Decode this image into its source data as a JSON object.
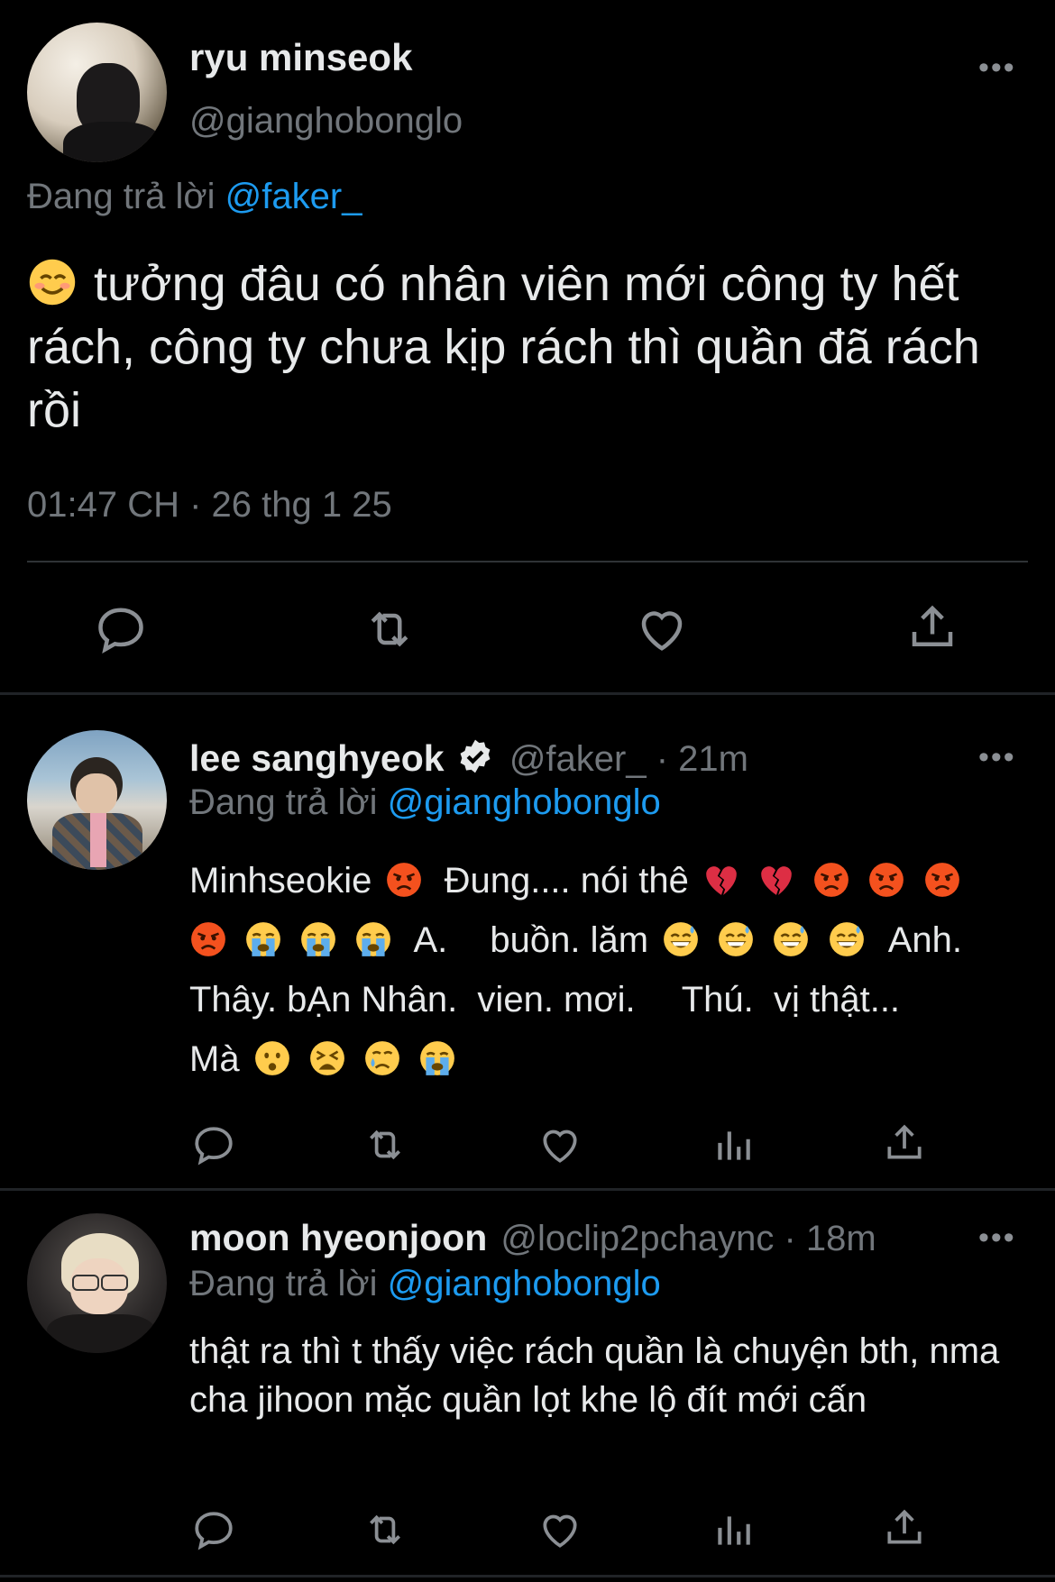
{
  "main_tweet": {
    "name": "ryu minseok",
    "handle": "@gianghobonglo",
    "replying_label": "Đang trả lời",
    "replying_to": "@faker_",
    "text": "tưởng đâu có nhân viên mới công ty hết rách, công ty chưa kịp rách thì quần đã rách rồi",
    "timestamp": "01:47 CH · 26 thg 1 25",
    "more_label": "•••"
  },
  "replies": [
    {
      "name": "lee sanghyeok",
      "verified": true,
      "handle": "@faker_",
      "time": "· 21m",
      "replying_label": "Đang trả lời",
      "replying_to": "@gianghobonglo",
      "text_segments": {
        "s1": "Minhseokie",
        "s2": "Đung.... nói thê",
        "s3": "A.",
        "s4": "buồn. lăm",
        "s5": "Anh.",
        "s6": "Thây. bẠn Nhân.  vien. mơi.",
        "s7": "Thú.  vị thật...",
        "s8": "Mà"
      },
      "more_label": "•••"
    },
    {
      "name": "moon hyeonjoon",
      "handle": "@loclip2pchaync",
      "time": "· 18m",
      "replying_label": "Đang trả lời",
      "replying_to": "@gianghobonglo",
      "text": "thật ra thì t thấy việc rách quần là chuyện bth, nma cha jihoon mặc quần lọt khe lộ đít mới cấn",
      "more_label": "•••"
    }
  ],
  "colors": {
    "background": "#000000",
    "text": "#e7e9ea",
    "muted": "#71767b",
    "link": "#1d9bf0",
    "divider": "#202327"
  }
}
